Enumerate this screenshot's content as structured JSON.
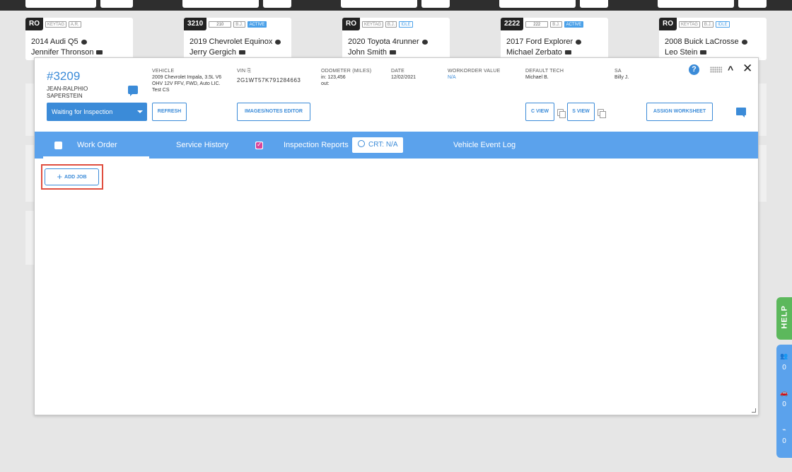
{
  "background_cards": [
    {
      "ro": "RO",
      "tags": [
        "KEYTAG",
        "A.R."
      ],
      "vehicle": "2014 Audi Q5",
      "customer": "Jennifer Thronson"
    },
    {
      "ro": "3210",
      "tags": [
        "210",
        "B.J.",
        "ACTIVE"
      ],
      "vehicle": "2019 Chevrolet Equinox",
      "customer": "Jerry Gergich"
    },
    {
      "ro": "RO",
      "tags": [
        "KEYTAG",
        "B.J.",
        "IDLE"
      ],
      "vehicle": "2020 Toyota 4runner",
      "customer": "John Smith"
    },
    {
      "ro": "2222",
      "tags": [
        "222",
        "B.J.",
        "ACTIVE"
      ],
      "vehicle": "2017 Ford Explorer",
      "customer": "Michael Zerbato"
    },
    {
      "ro": "RO",
      "tags": [
        "KEYTAG",
        "B.J.",
        "IDLE"
      ],
      "vehicle": "2008 Buick LaCrosse",
      "customer": "Leo Stein"
    }
  ],
  "workorder": {
    "number": "#3209",
    "customer": "JEAN-RALPHIO SAPERSTEIN",
    "vehicle_label": "VEHICLE",
    "vehicle_value": "2009 Chevrolet Impala, 3.5L V6 OHV 12V FFV, FWD, Auto LIC. Test CS",
    "vin_label": "VIN",
    "vin_value": "2G1WT57K791284663",
    "odometer_label": "ODOMETER (MILES)",
    "odometer_in": "in: 123,456",
    "odometer_out": "out:",
    "date_label": "DATE",
    "date_value": "12/02/2021",
    "wo_value_label": "WORKORDER VALUE",
    "wo_value": "N/A",
    "tech_label": "DEFAULT TECH",
    "tech_value": "Michael B.",
    "sa_label": "SA",
    "sa_value": "Billy J."
  },
  "controls": {
    "status": "Waiting for Inspection",
    "refresh": "REFRESH",
    "images_notes": "IMAGES/NOTES EDITOR",
    "c_view": "C VIEW",
    "s_view": "S VIEW",
    "assign_worksheet": "ASSIGN WORKSHEET",
    "help_q": "?",
    "close": "✕",
    "collapse": "^"
  },
  "tabs": {
    "work_order": "Work Order",
    "service_history": "Service History",
    "inspection_reports": "Inspection Reports",
    "crt": "CRT: N/A",
    "vehicle_event_log": "Vehicle Event Log"
  },
  "add_job": "ADD JOB",
  "side": {
    "help": "HELP",
    "counts": [
      "0",
      "0",
      "0"
    ]
  },
  "colors": {
    "accent": "#3b8bd8",
    "tabbar": "#5ba2ec",
    "highlight": "#e04e3f",
    "help_green": "#5cb85c"
  }
}
